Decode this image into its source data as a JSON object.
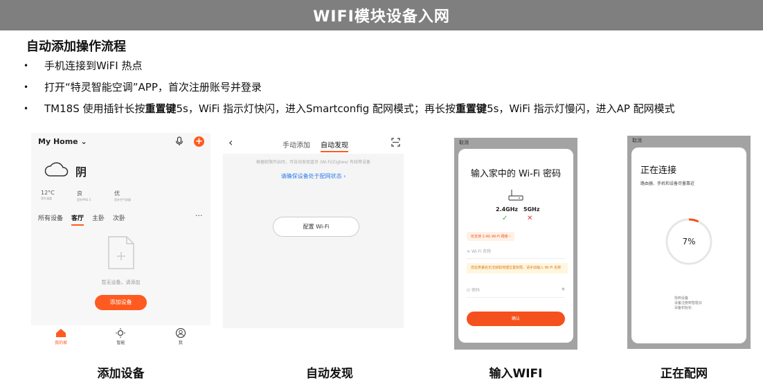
{
  "header": {
    "title": "WIFI模块设备入网"
  },
  "section": {
    "title": "自动添加操作流程"
  },
  "bullets": {
    "dot": "•",
    "b1": "手机连接到WiFI 热点",
    "b2": "打开“特灵智能空调”APP，首次注册账号并登录",
    "b3_a": "TM18S 使用插针长按",
    "b3_b": "重置键",
    "b3_c": "5s，WiFi 指示灯快闪，进入Smartconfig 配网模式；再长按",
    "b3_d": "重置键",
    "b3_e": "5s，WiFi 指示灯慢闪，进入AP 配网模式"
  },
  "phone1": {
    "home_label": "My Home",
    "weather": "阴",
    "temp": "12°C",
    "temp_label": "室外温度",
    "pm": "良",
    "pm_label": "室外PM2.5",
    "air": "优",
    "air_label": "室外空气质量",
    "tabs": [
      "所有设备",
      "客厅",
      "主卧",
      "次卧"
    ],
    "more": "···",
    "empty": "暂无设备，请添加",
    "add_button": "添加设备",
    "nav": [
      "我的家",
      "智能",
      "我"
    ]
  },
  "phone2": {
    "tab_manual": "手动添加",
    "tab_auto": "自动发现",
    "hint": "根据权限开启时，可自动发现蓝牙 /Wi-Fi/Zigbee/ 有线等设备",
    "link": "请确保设备处于配网状态 ›",
    "config_button": "配置 Wi-Fi"
  },
  "phone3": {
    "cancel": "取消",
    "heading": "输入家中的 Wi-Fi 密码",
    "band_24": "2.4GHz",
    "band_5": "5GHz",
    "tag": "仅支持 2.4G Wi-Fi 网络 ›",
    "wifi_name": "Wi-Fi 名称",
    "warning": "您这类署名无法获取地理位置权限，请手动输入 Wi-Fi 名称",
    "password": "密码",
    "confirm": "确认"
  },
  "phone4": {
    "cancel": "取消",
    "heading": "正在连接",
    "sub": "路由器、手机和设备尽量靠近",
    "percent": "7%",
    "progress": 0.07,
    "step1": "找到设备",
    "step2": "设备注册到智能云",
    "step3": "设备初始化"
  },
  "captions": {
    "c1": "添加设备",
    "c2": "自动发现",
    "c3": "输入WIFI",
    "c4": "正在配网"
  },
  "colors": {
    "accent": "#ff5a1f",
    "link": "#2b7de9",
    "header_bg": "#7f7f7f"
  }
}
